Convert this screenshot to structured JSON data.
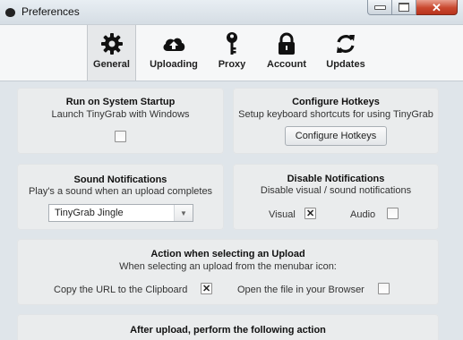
{
  "window": {
    "title": "Preferences",
    "controls": {
      "minimize_icon": "minimize-icon",
      "maximize_icon": "maximize-icon",
      "close_glyph": "✕"
    }
  },
  "tabs": [
    {
      "label": "General",
      "icon": "gear-icon",
      "selected": true
    },
    {
      "label": "Uploading",
      "icon": "cloud-upload-icon",
      "selected": false
    },
    {
      "label": "Proxy",
      "icon": "key-icon",
      "selected": false
    },
    {
      "label": "Account",
      "icon": "lock-icon",
      "selected": false
    },
    {
      "label": "Updates",
      "icon": "refresh-icon",
      "selected": false
    }
  ],
  "startup": {
    "title": "Run on System Startup",
    "subtitle": "Launch TinyGrab with Windows",
    "checked": false
  },
  "hotkeys": {
    "title": "Configure Hotkeys",
    "subtitle": "Setup keyboard shortcuts for using TinyGrab",
    "button_label": "Configure Hotkeys"
  },
  "sound": {
    "title": "Sound Notifications",
    "subtitle": "Play's a sound when an upload completes",
    "selected": "TinyGrab Jingle"
  },
  "disable_notifications": {
    "title": "Disable Notifications",
    "subtitle": "Disable visual / sound notifications",
    "visual_label": "Visual",
    "visual_checked": true,
    "audio_label": "Audio",
    "audio_checked": false
  },
  "action_select": {
    "title": "Action when selecting an Upload",
    "subtitle": "When selecting an upload from the menubar icon:",
    "copy_label": "Copy the URL to the Clipboard",
    "copy_checked": true,
    "open_label": "Open the file in your Browser",
    "open_checked": false
  },
  "after_upload": {
    "title": "After upload, perform the following action"
  },
  "colors": {
    "window_bg": "#dfe5ea",
    "panel_bg": "#eaeced",
    "toolbar_bg": "#f6f7f8",
    "close_button": "#c9482f"
  }
}
